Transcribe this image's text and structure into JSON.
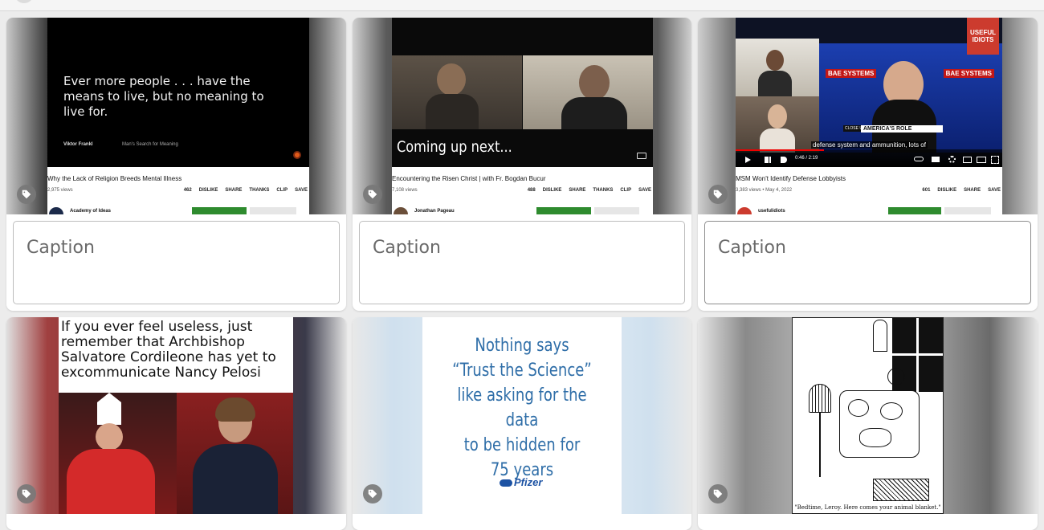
{
  "cards": [
    {
      "caption_placeholder": "Caption",
      "video": {
        "quote": "Ever more people . . . have the means to live, but no meaning to live for.",
        "quote_author": "Viktor Frankl",
        "quote_book": "Man's Search for Meaning",
        "title": "Why the Lack of Religion Breeds Mental Illness",
        "views": "2,975 views",
        "likes": "462",
        "actions": [
          "DISLIKE",
          "SHARE",
          "THANKS",
          "CLIP",
          "SAVE"
        ],
        "channel": "Academy of Ideas"
      }
    },
    {
      "caption_placeholder": "Caption",
      "video": {
        "overlay": "Coming up next...",
        "title": "Encountering the Risen Christ | with Fr. Bogdan Bucur",
        "views": "7,108 views",
        "likes": "488",
        "actions": [
          "DISLIKE",
          "SHARE",
          "THANKS",
          "CLIP",
          "SAVE"
        ],
        "channel": "Jonathan Pageau"
      }
    },
    {
      "caption_placeholder": "Caption",
      "video": {
        "banner1": "BAE SYSTEMS",
        "banner2": "BAE SYSTEMS",
        "lower_third": "AMERICA'S ROLE",
        "close_up": "CLOSE UP",
        "subtitle": "defense system and ammunition, lots of",
        "time": "0:46 / 2:19",
        "channel_badge": "USEFUL IDIOTS",
        "title": "MSM Won't Identify Defense Lobbyists",
        "views": "3,383 views • May 4, 2022",
        "likes": "601",
        "actions": [
          "DISLIKE",
          "SHARE",
          "SAVE"
        ],
        "channel": "usefulidiots"
      }
    },
    {
      "meme_text": "If you ever feel useless, just remember that Archbishop Salvatore Cordileone has yet to excommunicate Nancy Pelosi"
    },
    {
      "lines": [
        "Nothing says",
        "“Trust the Science”",
        "like asking for the data",
        "to be hidden for",
        "75 years"
      ],
      "logo": "Pfizer"
    },
    {
      "caption": "\"Bedtime, Leroy. Here comes your animal blanket.\""
    }
  ],
  "colors": {
    "tag_button": "#787878",
    "pfizer_blue": "#2f6ea8",
    "like_green": "#2e8b2e"
  }
}
